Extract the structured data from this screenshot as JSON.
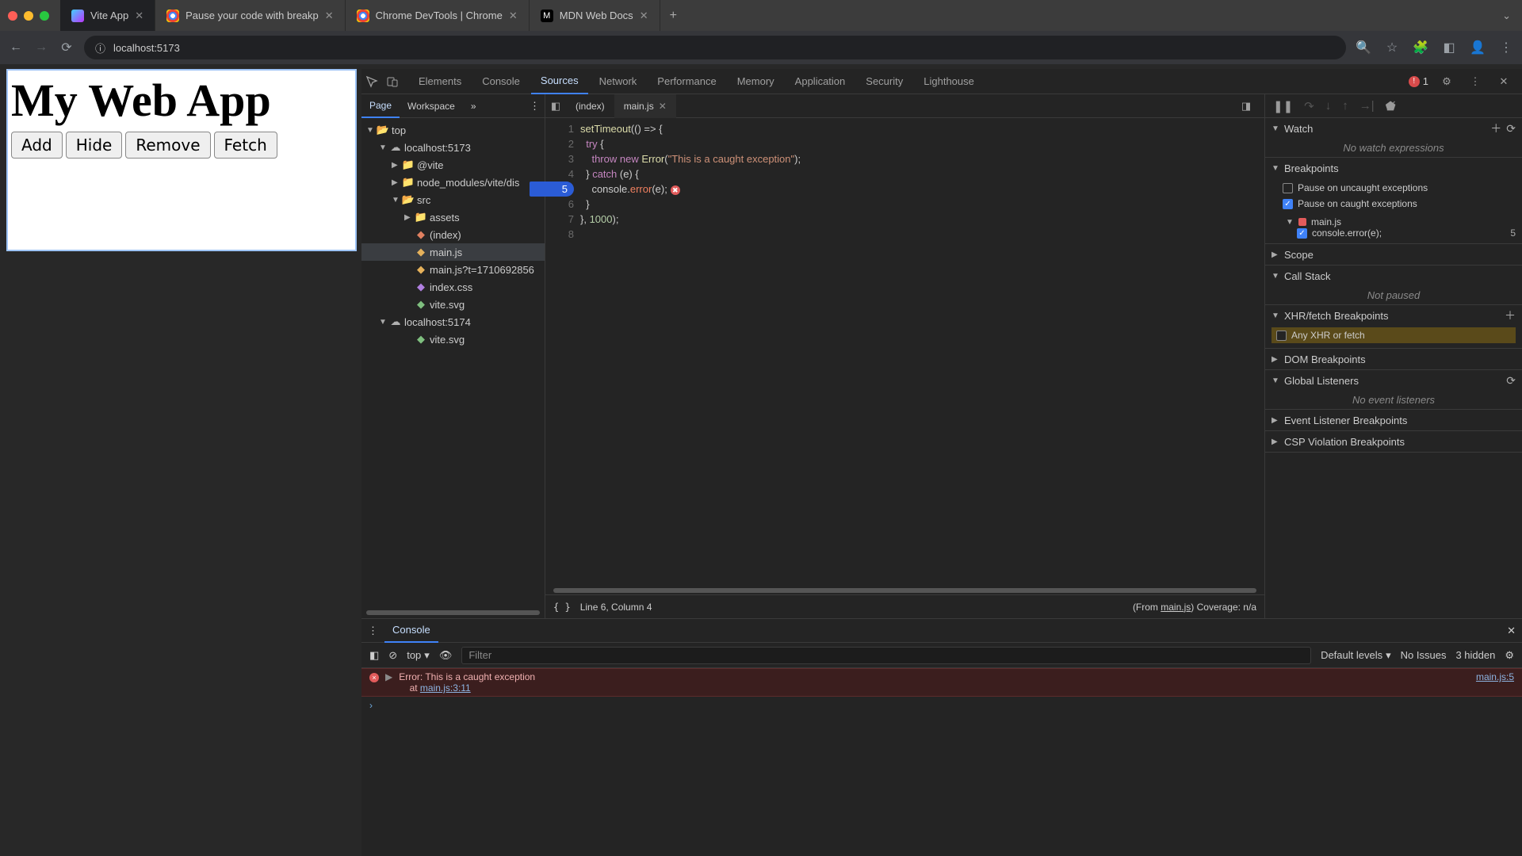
{
  "browser": {
    "tabs": [
      {
        "title": "Vite App",
        "favicon": "vite"
      },
      {
        "title": "Pause your code with breakp",
        "favicon": "chrome"
      },
      {
        "title": "Chrome DevTools | Chrome",
        "favicon": "chrome"
      },
      {
        "title": "MDN Web Docs",
        "favicon": "mdn"
      }
    ],
    "url": "localhost:5173"
  },
  "page": {
    "heading": "My Web App",
    "buttons": [
      "Add",
      "Hide",
      "Remove",
      "Fetch"
    ]
  },
  "devtools": {
    "main_tabs": [
      "Elements",
      "Console",
      "Sources",
      "Network",
      "Performance",
      "Memory",
      "Application",
      "Security",
      "Lighthouse"
    ],
    "active_tab": "Sources",
    "error_count": "1",
    "navigator": {
      "tabs": [
        "Page",
        "Workspace"
      ],
      "tree": [
        {
          "d": 0,
          "k": "folder-open",
          "t": "top"
        },
        {
          "d": 1,
          "k": "cloud",
          "t": "localhost:5173"
        },
        {
          "d": 2,
          "k": "folder",
          "t": "@vite"
        },
        {
          "d": 2,
          "k": "folder",
          "t": "node_modules/vite/dis"
        },
        {
          "d": 2,
          "k": "folder-open",
          "t": "src"
        },
        {
          "d": 3,
          "k": "folder",
          "t": "assets"
        },
        {
          "d": 3,
          "k": "html",
          "t": "(index)"
        },
        {
          "d": 3,
          "k": "js",
          "t": "main.js",
          "sel": true
        },
        {
          "d": 3,
          "k": "js",
          "t": "main.js?t=1710692856"
        },
        {
          "d": 3,
          "k": "css",
          "t": "index.css"
        },
        {
          "d": 3,
          "k": "svg",
          "t": "vite.svg"
        },
        {
          "d": 1,
          "k": "cloud",
          "t": "localhost:5174"
        },
        {
          "d": 3,
          "k": "svg",
          "t": "vite.svg"
        }
      ]
    },
    "editor": {
      "tabs": [
        "(index)",
        "main.js"
      ],
      "active": "main.js",
      "lines": [
        "setTimeout(() => {",
        "  try {",
        "    throw new Error(\"This is a caught exception\");",
        "  } catch (e) {",
        "    console.error(e);",
        "  }",
        "}, 1000);",
        ""
      ],
      "bp_line": 5,
      "status": "Line 6, Column 4",
      "coverage_prefix": "(From ",
      "coverage_file": "main.js",
      "coverage_suffix": ") Coverage: n/a"
    },
    "debug": {
      "watch": {
        "title": "Watch",
        "empty": "No watch expressions"
      },
      "breakpoints": {
        "title": "Breakpoints",
        "pause_uncaught": "Pause on uncaught exceptions",
        "pause_caught": "Pause on caught exceptions",
        "file": "main.js",
        "line_text": "console.error(e);",
        "line_no": "5"
      },
      "scope": "Scope",
      "callstack": {
        "title": "Call Stack",
        "empty": "Not paused"
      },
      "xhr": {
        "title": "XHR/fetch Breakpoints",
        "any": "Any XHR or fetch"
      },
      "dom": "DOM Breakpoints",
      "gl": {
        "title": "Global Listeners",
        "empty": "No event listeners"
      },
      "elb": "Event Listener Breakpoints",
      "csp": "CSP Violation Breakpoints"
    },
    "console": {
      "tab": "Console",
      "context": "top",
      "filter_placeholder": "Filter",
      "levels": "Default levels",
      "issues": "No Issues",
      "hidden": "3 hidden",
      "error_msg": "Error: This is a caught exception\n    at ",
      "error_at": "main.js:3:11",
      "error_src": "main.js:5"
    }
  }
}
